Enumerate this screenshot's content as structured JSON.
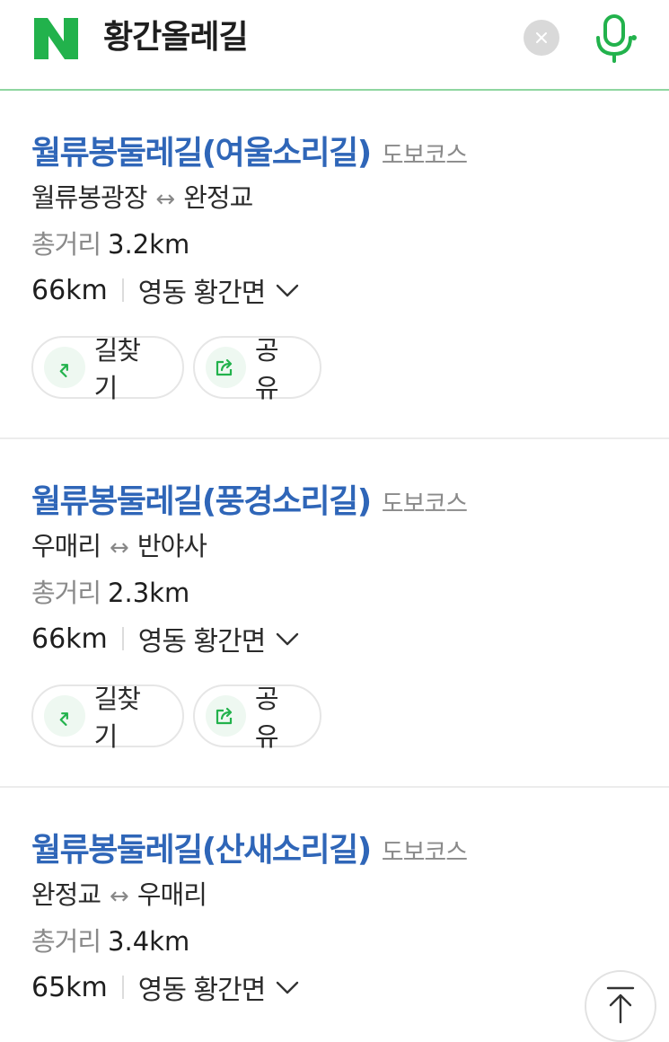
{
  "search": {
    "logo_letter": "N",
    "query": "황간올레길"
  },
  "colors": {
    "brand_green": "#22b24c",
    "title_blue": "#2f66b8",
    "accent_line": "#8fd6a0"
  },
  "icons": [
    "naver-logo-icon",
    "clear-icon",
    "microphone-icon",
    "chevron-down-icon",
    "directions-icon",
    "share-icon",
    "arrow-up-icon"
  ],
  "results": [
    {
      "title": "월류봉둘레길(여울소리길)",
      "category": "도보코스",
      "start": "월류봉광장",
      "end": "완정교",
      "arrow": "↔",
      "distance_label": "총거리",
      "distance_value": "3.2km",
      "km_away": "66km",
      "area": "영동 황간면",
      "directions_label": "길찾기",
      "share_label": "공유"
    },
    {
      "title": "월류봉둘레길(풍경소리길)",
      "category": "도보코스",
      "start": "우매리",
      "end": "반야사",
      "arrow": "↔",
      "distance_label": "총거리",
      "distance_value": "2.3km",
      "km_away": "66km",
      "area": "영동 황간면",
      "directions_label": "길찾기",
      "share_label": "공유"
    },
    {
      "title": "월류봉둘레길(산새소리길)",
      "category": "도보코스",
      "start": "완정교",
      "end": "우매리",
      "arrow": "↔",
      "distance_label": "총거리",
      "distance_value": "3.4km",
      "km_away": "65km",
      "area": "영동 황간면"
    }
  ]
}
